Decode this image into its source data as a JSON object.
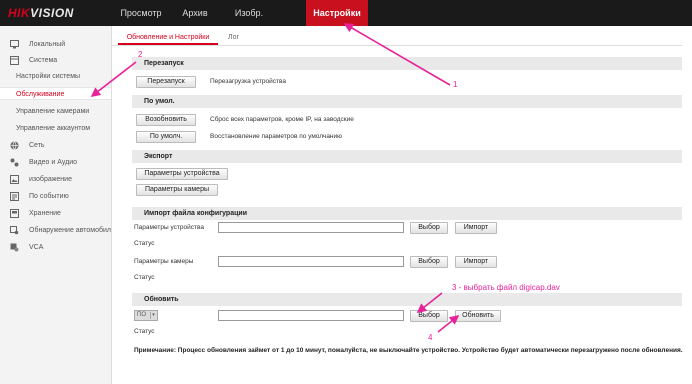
{
  "header": {
    "logo_prefix": "HIK",
    "logo_suffix": "VISION",
    "nav": [
      {
        "label": "Просмотр"
      },
      {
        "label": "Архив"
      },
      {
        "label": "Изобр."
      },
      {
        "label": "Настройки"
      }
    ]
  },
  "sidebar": {
    "items": [
      {
        "label": "Локальный",
        "icon": "monitor-icon"
      },
      {
        "label": "Система",
        "icon": "system-icon"
      },
      {
        "label": "Настройки системы"
      },
      {
        "label": "Обслуживание"
      },
      {
        "label": "Управление камерами"
      },
      {
        "label": "Управление аккаунтом"
      },
      {
        "label": "Сеть",
        "icon": "globe-icon"
      },
      {
        "label": "Видео и Аудио",
        "icon": "video-audio-icon"
      },
      {
        "label": "изображение",
        "icon": "image-icon"
      },
      {
        "label": "По событию",
        "icon": "event-icon"
      },
      {
        "label": "Хранение",
        "icon": "storage-icon"
      },
      {
        "label": "Обнаружение автомобиля",
        "icon": "vehicle-detection-icon"
      },
      {
        "label": "VCA",
        "icon": "vca-icon"
      }
    ]
  },
  "tabs": [
    {
      "label": "Обновление и Настройки"
    },
    {
      "label": "Лог"
    }
  ],
  "sections": {
    "restart": {
      "title": "Перезапуск",
      "button": "Перезапуск",
      "description": "Перезагрузка устройства"
    },
    "defaults": {
      "title": "По умол.",
      "restore_button": "Возобновить",
      "restore_description": "Сброс всех параметров, кроме IP, на заводские",
      "default_button": "По умолч.",
      "default_description": "Восстановление параметров по умолчанию"
    },
    "export": {
      "title": "Экспорт",
      "device_params_button": "Параметры устройства",
      "camera_params_button": "Параметры камеры"
    },
    "import": {
      "title": "Импорт файла конфигурации",
      "device_params_label": "Параметры устройства",
      "camera_params_label": "Параметры камеры",
      "browse_button": "Выбор",
      "import_button": "Импорт",
      "status_label": "Статус"
    },
    "upgrade": {
      "title": "Обновить",
      "select_value": "ПО",
      "browse_button": "Выбор",
      "upgrade_button": "Обновить",
      "status_label": "Статус"
    }
  },
  "note": "Примечание: Процесс обновления займет от 1 до 10 минут, пожалуйста, не выключайте устройство. Устройство будет автоматически перезагружено после обновления.",
  "annotations": {
    "a1": "1",
    "a2": "2",
    "a3": "3 - выбрать файл digicap.dav",
    "a4": "4"
  },
  "colors": {
    "accent_red": "#d6001c",
    "annotation_pink": "#e7239a",
    "topbar": "#1a1a1a"
  }
}
